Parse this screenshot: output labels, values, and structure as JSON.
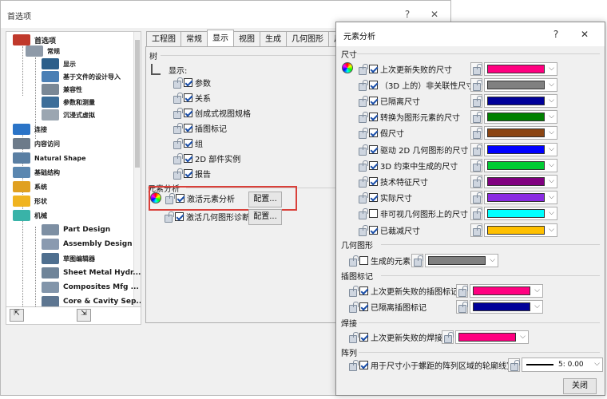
{
  "pref": {
    "title": "首选项",
    "help_btn": "?",
    "close_btn": "✕",
    "tree": [
      {
        "label": "首选项",
        "color": "#c0392b"
      },
      {
        "label": "常规",
        "color": "#8e9aa8"
      },
      {
        "label": "显示",
        "color": "#2c5f8a"
      },
      {
        "label": "基于文件的设计导入",
        "color": "#4a7fb5"
      },
      {
        "label": "兼容性",
        "color": "#7a8896"
      },
      {
        "label": "参数和测量",
        "color": "#3d6e99"
      },
      {
        "label": "沉浸式虚拟",
        "color": "#9ba6b1"
      },
      {
        "label": "连接",
        "color": "#2b74c7"
      },
      {
        "label": "内容访问",
        "color": "#6d7b8a"
      },
      {
        "label": "Natural Shape",
        "color": "#5a7fa3"
      },
      {
        "label": "基础结构",
        "color": "#5b87b0"
      },
      {
        "label": "系统",
        "color": "#e0a020"
      },
      {
        "label": "形状",
        "color": "#f0b420"
      },
      {
        "label": "机械",
        "color": "#39b3a8"
      },
      {
        "label": "Part Design",
        "color": "#7d8fa3"
      },
      {
        "label": "Assembly Design",
        "color": "#8a9ab0"
      },
      {
        "label": "草图编辑器",
        "color": "#4f6f8f"
      },
      {
        "label": "Sheet Metal Hydr...",
        "color": "#6f8499"
      },
      {
        "label": "Composites Mfg ...",
        "color": "#8295aa"
      },
      {
        "label": "Core & Cavity Sep...",
        "color": "#5e7691"
      }
    ],
    "tabs": [
      "工程图",
      "常规",
      "显示",
      "视图",
      "生成",
      "几何图形",
      "尺"
    ],
    "active_tab": 2,
    "tree_section": "树",
    "display_label": "显示:",
    "display_options": [
      "参数",
      "关系",
      "创成式视图规格",
      "插图标记",
      "组",
      "2D 部件实例",
      "报告"
    ],
    "analysis_section": "元素分析",
    "analysis_options": [
      {
        "label": "激活元素分析",
        "button": "配置..."
      },
      {
        "label": "激活几何图形诊断",
        "button": "配置..."
      }
    ]
  },
  "dialog": {
    "title": "元素分析",
    "help_btn": "?",
    "close_btn": "✕",
    "size_group": "尺寸",
    "size_rows": [
      {
        "label": "上次更新失败的尺寸",
        "checked": true,
        "color": "#ff0080"
      },
      {
        "label": "（3D 上的）非关联性尺寸",
        "checked": true,
        "color": "#808080"
      },
      {
        "label": "已隔离尺寸",
        "checked": true,
        "color": "#000099"
      },
      {
        "label": "转换为图形元素的尺寸",
        "checked": true,
        "color": "#008000"
      },
      {
        "label": "假尺寸",
        "checked": true,
        "color": "#8b4513"
      },
      {
        "label": "驱动 2D 几何图形的尺寸",
        "checked": true,
        "color": "#0000ff"
      },
      {
        "label": "3D 约束中生成的尺寸",
        "checked": true,
        "color": "#00cc33"
      },
      {
        "label": "技术特征尺寸",
        "checked": true,
        "color": "#800080"
      },
      {
        "label": "实际尺寸",
        "checked": true,
        "color": "#8a2be2"
      },
      {
        "label": "非可视几何图形上的尺寸",
        "checked": false,
        "color": "#00ffff"
      },
      {
        "label": "已裁减尺寸",
        "checked": true,
        "color": "#ffc000"
      }
    ],
    "geometry_group": "几何图形",
    "geometry_rows": [
      {
        "label": "生成的元素",
        "checked": false,
        "color": "#808080"
      }
    ],
    "callout_group": "插图标记",
    "callout_rows": [
      {
        "label": "上次更新失败的插图标记",
        "checked": true,
        "color": "#ff0080"
      },
      {
        "label": "已隔离插图标记",
        "checked": true,
        "color": "#000099"
      }
    ],
    "weld_group": "焊接",
    "weld_rows": [
      {
        "label": "上次更新失败的焊接",
        "checked": true,
        "color": "#ff0080"
      }
    ],
    "array_group": "阵列",
    "array_row": {
      "label": "用于尺寸小于螺距的阵列区域的轮廓线宽",
      "checked": true,
      "value": "5: 0.00"
    },
    "close_label": "关闭"
  }
}
